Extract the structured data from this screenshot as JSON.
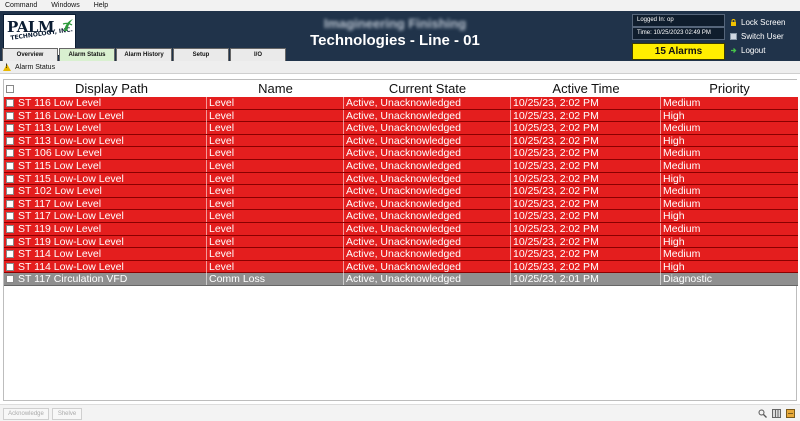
{
  "menu": [
    "Command",
    "Windows",
    "Help"
  ],
  "logo": {
    "name": "PALM",
    "sub": "TECHNOLOGY, INC."
  },
  "header": {
    "subtitle": "Imagineering Finishing",
    "title": "Technologies - Line - 01",
    "logged_in": "Logged In: op",
    "time": "Time: 10/25/2023 02:49 PM",
    "alarm_count": "15 Alarms",
    "lock_label": "Lock Screen",
    "switch_label": "Switch User",
    "logout_label": "Logout"
  },
  "tabs": [
    {
      "label": "Overview",
      "active": false
    },
    {
      "label": "Alarm Status",
      "active": true
    },
    {
      "label": "Alarm History",
      "active": false
    },
    {
      "label": "Setup",
      "active": false
    },
    {
      "label": "I/O",
      "active": false
    }
  ],
  "status_label": "Alarm Status",
  "table": {
    "columns": [
      "Display Path",
      "Name",
      "Current State",
      "Active Time",
      "Priority"
    ],
    "rows": [
      {
        "path": "ST 116 Low Level",
        "name": "Level",
        "state": "Active, Unacknowledged",
        "time": "10/25/23, 2:02 PM",
        "priority": "Medium",
        "color": "red"
      },
      {
        "path": "ST 116 Low-Low Level",
        "name": "Level",
        "state": "Active, Unacknowledged",
        "time": "10/25/23, 2:02 PM",
        "priority": "High",
        "color": "red"
      },
      {
        "path": "ST 113 Low Level",
        "name": "Level",
        "state": "Active, Unacknowledged",
        "time": "10/25/23, 2:02 PM",
        "priority": "Medium",
        "color": "red"
      },
      {
        "path": "ST 113 Low-Low Level",
        "name": "Level",
        "state": "Active, Unacknowledged",
        "time": "10/25/23, 2:02 PM",
        "priority": "High",
        "color": "red"
      },
      {
        "path": "ST 106 Low Level",
        "name": "Level",
        "state": "Active, Unacknowledged",
        "time": "10/25/23, 2:02 PM",
        "priority": "Medium",
        "color": "red"
      },
      {
        "path": "ST 115 Low Level",
        "name": "Level",
        "state": "Active, Unacknowledged",
        "time": "10/25/23, 2:02 PM",
        "priority": "Medium",
        "color": "red"
      },
      {
        "path": "ST 115 Low-Low Level",
        "name": "Level",
        "state": "Active, Unacknowledged",
        "time": "10/25/23, 2:02 PM",
        "priority": "High",
        "color": "red"
      },
      {
        "path": "ST 102 Low Level",
        "name": "Level",
        "state": "Active, Unacknowledged",
        "time": "10/25/23, 2:02 PM",
        "priority": "Medium",
        "color": "red"
      },
      {
        "path": "ST 117 Low Level",
        "name": "Level",
        "state": "Active, Unacknowledged",
        "time": "10/25/23, 2:02 PM",
        "priority": "Medium",
        "color": "red"
      },
      {
        "path": "ST 117 Low-Low Level",
        "name": "Level",
        "state": "Active, Unacknowledged",
        "time": "10/25/23, 2:02 PM",
        "priority": "High",
        "color": "red"
      },
      {
        "path": "ST 119 Low Level",
        "name": "Level",
        "state": "Active, Unacknowledged",
        "time": "10/25/23, 2:02 PM",
        "priority": "Medium",
        "color": "red"
      },
      {
        "path": "ST 119 Low-Low Level",
        "name": "Level",
        "state": "Active, Unacknowledged",
        "time": "10/25/23, 2:02 PM",
        "priority": "High",
        "color": "red"
      },
      {
        "path": "ST 114 Low Level",
        "name": "Level",
        "state": "Active, Unacknowledged",
        "time": "10/25/23, 2:02 PM",
        "priority": "Medium",
        "color": "red"
      },
      {
        "path": "ST 114 Low-Low Level",
        "name": "Level",
        "state": "Active, Unacknowledged",
        "time": "10/25/23, 2:02 PM",
        "priority": "High",
        "color": "red"
      },
      {
        "path": "ST 117 Circulation VFD",
        "name": "Comm Loss",
        "state": "Active, Unacknowledged",
        "time": "10/25/23, 2:01 PM",
        "priority": "Diagnostic",
        "color": "grey"
      }
    ]
  },
  "footer": {
    "acknowledge_label": "Acknowledge",
    "shelve_label": "Shelve"
  },
  "colors": {
    "header_bg": "#20334a",
    "alarm_red": "#e41e1e",
    "diagnostic_grey": "#8f8f8f",
    "alarm_badge": "#ffee00"
  }
}
